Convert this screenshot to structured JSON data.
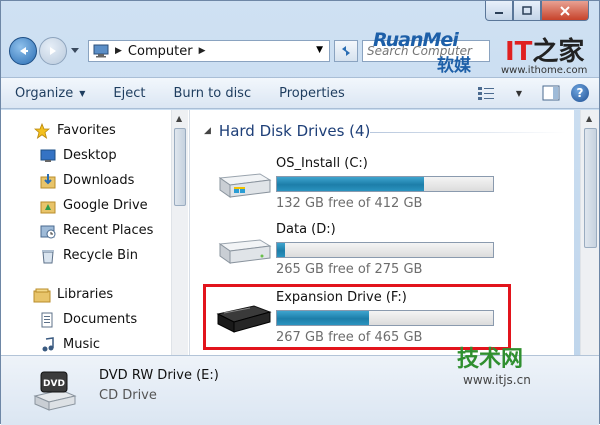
{
  "address": {
    "crumb": "Computer",
    "search_placeholder": "Search Computer"
  },
  "watermarks": {
    "ruanmei": "RuanMei",
    "ruanmei_cn": "软媒",
    "ithome_logo_i": "IT",
    "ithome_logo_cn": "之家",
    "ithome_url": "www.ithome.com",
    "itjs_logo": "技术网",
    "itjs_url": "www.itjs.cn"
  },
  "toolbar": {
    "organize": "Organize",
    "eject": "Eject",
    "burn": "Burn to disc",
    "properties": "Properties"
  },
  "nav": {
    "favorites_head": "Favorites",
    "favorites": [
      "Desktop",
      "Downloads",
      "Google Drive",
      "Recent Places",
      "Recycle Bin"
    ],
    "libraries_head": "Libraries",
    "libraries": [
      "Documents",
      "Music"
    ]
  },
  "content": {
    "group_title": "Hard Disk Drives (4)",
    "drives": [
      {
        "name": "OS_Install (C:)",
        "free_text": "132 GB free of 412 GB",
        "used_fraction": 0.68
      },
      {
        "name": "Data (D:)",
        "free_text": "265 GB free of 275 GB",
        "used_fraction": 0.036
      },
      {
        "name": "Expansion Drive (F:)",
        "free_text": "267 GB free of 465 GB",
        "used_fraction": 0.426
      }
    ]
  },
  "details": {
    "name": "DVD RW Drive (E:)",
    "type": "CD Drive",
    "icon_label": "DVD"
  },
  "colors": {
    "accent": "#1e3f78",
    "bar_fill": "#1d7ea9",
    "highlight": "#e2141c"
  }
}
